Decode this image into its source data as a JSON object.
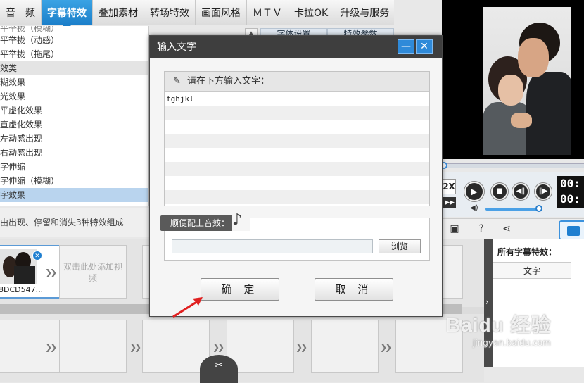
{
  "tabs": [
    "音　频",
    "字幕特效",
    "叠加素材",
    "转场特效",
    "画面风格",
    "ＭＴＶ",
    "卡拉OK",
    "升级与服务"
  ],
  "active_tab_index": 1,
  "effect_list": {
    "items": [
      "平举拢（模糊）",
      "平举拢（动感）",
      "平举拢（拖尾）",
      "效类",
      "糊效果",
      "光效果",
      "平虚化效果",
      "直虚化效果",
      "左动感出现",
      "右动感出现",
      "字伸缩",
      "字伸缩（模糊）",
      "字效果"
    ],
    "description": "由出现、停留和消失3种特效组成"
  },
  "side_tabs": [
    "字体设置",
    "特效参数"
  ],
  "dialog": {
    "title": "输入文字",
    "prompt": "请在下方输入文字：",
    "text_value": "fghjkl",
    "sound_label": "顺便配上音效：",
    "sound_path": "",
    "browse_label": "浏览",
    "ok_label": "确 定",
    "cancel_label": "取 消",
    "minimize_symbol": "—",
    "close_symbol": "✕"
  },
  "player": {
    "speed_label": "2X",
    "time_top": "00:",
    "time_bottom": "00:"
  },
  "all_effects": {
    "title": "所有字幕特效：",
    "column": "文字"
  },
  "timeline": {
    "clip_caption": "8DCD547...",
    "add_video_hint": "双击此处添加视频"
  },
  "watermark": {
    "main": "Baidu 经验",
    "sub": "jingyan.baidu.com"
  },
  "colors": {
    "accent": "#1f7fd0",
    "titlebar": "#3e3e3e",
    "selection": "#b9d4ee",
    "arrow": "#e02020"
  }
}
